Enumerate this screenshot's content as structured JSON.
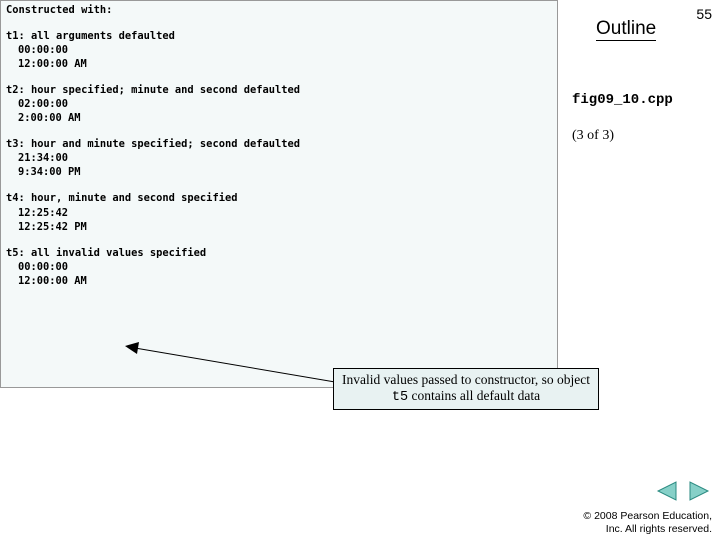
{
  "header": {
    "outline": "Outline",
    "page_number": "55",
    "filename": "fig09_10.cpp",
    "page_count": "(3 of 3)"
  },
  "output": {
    "title": "Constructed with:",
    "blocks": [
      {
        "label": "t1: all arguments defaulted",
        "line1": "00:00:00",
        "line2": "12:00:00 AM"
      },
      {
        "label": "t2: hour specified; minute and second defaulted",
        "line1": "02:00:00",
        "line2": "2:00:00 AM"
      },
      {
        "label": "t3: hour and minute specified; second defaulted",
        "line1": "21:34:00",
        "line2": "9:34:00 PM"
      },
      {
        "label": "t4: hour, minute and second specified",
        "line1": "12:25:42",
        "line2": "12:25:42 PM"
      },
      {
        "label": "t5: all invalid values specified",
        "line1": "00:00:00",
        "line2": "12:00:00 AM"
      }
    ]
  },
  "callout": {
    "part1": "Invalid values passed to constructor, so object ",
    "code": "t5",
    "part2": " contains all default data"
  },
  "footer": {
    "copyright_line1": "© 2008 Pearson Education,",
    "copyright_line2": "Inc.  All rights reserved."
  }
}
